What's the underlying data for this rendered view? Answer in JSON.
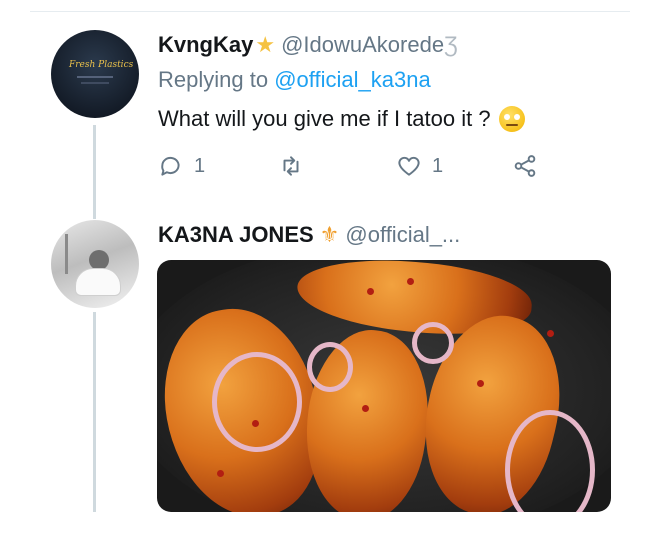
{
  "tweet1": {
    "display_name": "KvngKay",
    "name_badge_icon": "star-emoji-icon",
    "handle": "@IdowuAkorede",
    "handle_truncation": "Ʒ",
    "replying_prefix": "Replying to",
    "replying_mention": "@official_ka3na",
    "text": "What will you give me if I tatoo it ?",
    "text_emoji_icon": "face-with-rolling-eyes-icon",
    "avatar_logo_text": "Fresh Plastics",
    "actions": {
      "reply_count": "1",
      "retweet_count": "",
      "like_count": "1"
    }
  },
  "tweet2": {
    "display_name": "KA3NA JONES",
    "name_badge_icon": "fleur-de-lis-icon",
    "handle": "@official_...",
    "media_alt_icon": "food-photo"
  },
  "colors": {
    "link": "#1da1f2",
    "secondary_text": "#657786",
    "primary_text": "#14171a",
    "thread_line": "#cfd9de"
  }
}
